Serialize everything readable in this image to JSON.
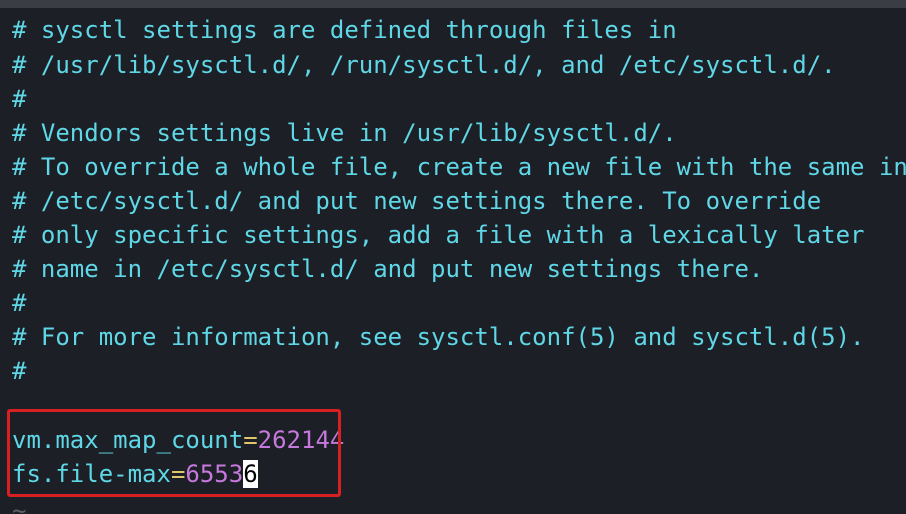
{
  "editor": {
    "comment_lines": [
      "# sysctl settings are defined through files in",
      "# /usr/lib/sysctl.d/, /run/sysctl.d/, and /etc/sysctl.d/.",
      "#",
      "# Vendors settings live in /usr/lib/sysctl.d/.",
      "# To override a whole file, create a new file with the same in",
      "# /etc/sysctl.d/ and put new settings there. To override",
      "# only specific settings, add a file with a lexically later",
      "# name in /etc/sysctl.d/ and put new settings there.",
      "#",
      "# For more information, see sysctl.conf(5) and sysctl.d(5).",
      "#"
    ],
    "settings": [
      {
        "key": "vm.max_map_count",
        "eq": "=",
        "value": "262144"
      },
      {
        "key": "fs.file-max",
        "eq": "=",
        "value_before_cursor": "6553",
        "cursor_char": "6"
      }
    ],
    "empty_line_marker": "~"
  },
  "colors": {
    "background": "#1c1f25",
    "comment": "#5fd7e6",
    "key": "#5fd7e6",
    "equals": "#e0c56a",
    "number": "#c678dd",
    "highlight_border": "#d92020",
    "cursor_bg": "#ffffff"
  }
}
